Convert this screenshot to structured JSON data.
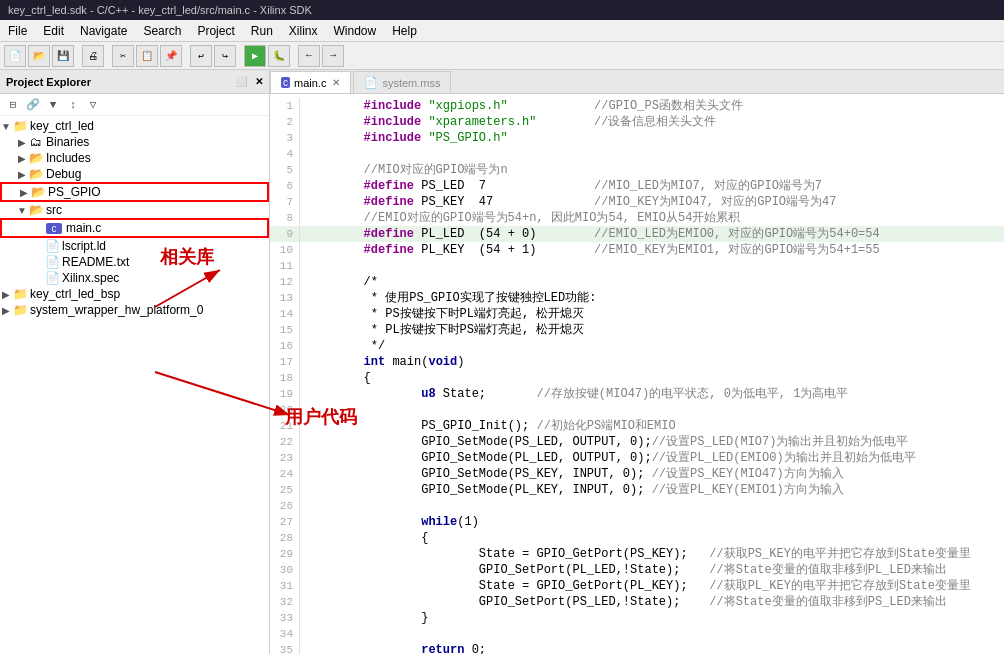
{
  "titlebar": {
    "text": "key_ctrl_led.sdk - C/C++ - key_ctrl_led/src/main.c - Xilinx SDK"
  },
  "menubar": {
    "items": [
      "File",
      "Edit",
      "Navigate",
      "Search",
      "Project",
      "Run",
      "Xilinx",
      "Window",
      "Help"
    ]
  },
  "project_explorer": {
    "title": "Project Explorer",
    "tree": [
      {
        "id": "key_ctrl_led",
        "label": "key_ctrl_led",
        "depth": 0,
        "type": "project",
        "expanded": true
      },
      {
        "id": "binaries",
        "label": "Binaries",
        "depth": 1,
        "type": "folder",
        "expanded": false
      },
      {
        "id": "includes",
        "label": "Includes",
        "depth": 1,
        "type": "folder",
        "expanded": false
      },
      {
        "id": "debug",
        "label": "Debug",
        "depth": 1,
        "type": "folder",
        "expanded": false
      },
      {
        "id": "ps_gpio",
        "label": "PS_GPIO",
        "depth": 1,
        "type": "folder",
        "expanded": false,
        "highlighted": true
      },
      {
        "id": "src",
        "label": "src",
        "depth": 1,
        "type": "folder",
        "expanded": true
      },
      {
        "id": "main_c",
        "label": "main.c",
        "depth": 2,
        "type": "c-file",
        "highlighted": true
      },
      {
        "id": "lscript_ld",
        "label": "lscript.ld",
        "depth": 2,
        "type": "ld-file"
      },
      {
        "id": "readme",
        "label": "README.txt",
        "depth": 2,
        "type": "txt-file"
      },
      {
        "id": "xilinx_spec",
        "label": "Xilinx.spec",
        "depth": 2,
        "type": "spec-file"
      },
      {
        "id": "key_ctrl_led_bsp",
        "label": "key_ctrl_led_bsp",
        "depth": 0,
        "type": "project",
        "expanded": false
      },
      {
        "id": "system_wrapper",
        "label": "system_wrapper_hw_platform_0",
        "depth": 0,
        "type": "project",
        "expanded": false
      }
    ]
  },
  "editor": {
    "tabs": [
      {
        "label": "main.c",
        "active": true,
        "icon": "c-file"
      },
      {
        "label": "system.mss",
        "active": false,
        "icon": "mss-file"
      }
    ],
    "lines": [
      {
        "num": "",
        "content": "\t#include \"xgpiops.h\"\t\t//GPIO_PS函数相关头文件"
      },
      {
        "num": "",
        "content": "\t#include \"xparameters.h\"\t//设备信息相关头文件"
      },
      {
        "num": "",
        "content": "\t#include \"PS_GPIO.h\""
      },
      {
        "num": "",
        "content": ""
      },
      {
        "num": "",
        "content": "\t//MIO对应的GPIO端号为n"
      },
      {
        "num": "",
        "content": "\t#define PS_LED\t7\t\t//MIO_LED为MIO7, 对应的GPIO端号为7"
      },
      {
        "num": "",
        "content": "\t#define PS_KEY\t47\t\t//MIO_KEY为MIO47, 对应的GPIO端号为47"
      },
      {
        "num": "",
        "content": "\t//EMIO对应的GPIO端号为54+n, 因此MIO为54, EMIO从54开始累积"
      },
      {
        "num": "",
        "content": "\t#define PL_LED\t(54 + 0)\t//EMIO_LED为EMIO0, 对应的GPIO端号为54+0=54",
        "highlight": true
      },
      {
        "num": "",
        "content": "\t#define PL_KEY\t(54 + 1)\t//EMIO_KEY为EMIO1, 对应的GPIO端号为54+1=55"
      },
      {
        "num": "",
        "content": ""
      },
      {
        "num": "",
        "content": "\t/*"
      },
      {
        "num": "",
        "content": "\t * 使用PS_GPIO实现了按键独控LED功能:"
      },
      {
        "num": "",
        "content": "\t * PS按键按下时PL端灯亮起, 松开熄灭"
      },
      {
        "num": "",
        "content": "\t * PL按键按下时PS端灯亮起, 松开熄灭"
      },
      {
        "num": "",
        "content": "\t */"
      },
      {
        "num": "",
        "content": "\tint main(void)"
      },
      {
        "num": "",
        "content": "\t{"
      },
      {
        "num": "",
        "content": "\t\tu8 State;\t//存放按键(MIO47)的电平状态, 0为低电平, 1为高电平"
      },
      {
        "num": "",
        "content": ""
      },
      {
        "num": "",
        "content": "\t\tPS_GPIO_Init();\t//初始化PS端MIO和EMIO"
      },
      {
        "num": "",
        "content": "\t\tGPIO_SetMode(PS_LED, OUTPUT, 0);//设置PS_LED(MIO7)为输出并且初始为低电平"
      },
      {
        "num": "",
        "content": "\t\tGPIO_SetMode(PL_LED, OUTPUT, 0);//设置PL_LED(EMIO0)为输出并且初始为低电平"
      },
      {
        "num": "",
        "content": "\t\tGPIO_SetMode(PS_KEY, INPUT, 0); //设置PS_KEY(MIO47)方向为输入"
      },
      {
        "num": "",
        "content": "\t\tGPIO_SetMode(PL_KEY, INPUT, 0); //设置PL_KEY(EMIO1)方向为输入"
      },
      {
        "num": "",
        "content": ""
      },
      {
        "num": "",
        "content": "\t\twhile(1)"
      },
      {
        "num": "",
        "content": "\t\t{"
      },
      {
        "num": "",
        "content": "\t\t\tState = GPIO_GetPort(PS_KEY);\t//获取PS_KEY的电平并把它存放到State变量里"
      },
      {
        "num": "",
        "content": "\t\t\tGPIO_SetPort(PL_LED,!State);\t//将State变量的值取非移到PL_LED来输出"
      },
      {
        "num": "",
        "content": "\t\t\tState = GPIO_GetPort(PL_KEY);\t//获取PL_KEY的电平并把它存放到State变量里"
      },
      {
        "num": "",
        "content": "\t\t\tGPIO_SetPort(PS_LED,!State);\t//将State变量的值取非移到PS_LED来输出"
      },
      {
        "num": "",
        "content": "\t\t}"
      },
      {
        "num": "",
        "content": ""
      },
      {
        "num": "",
        "content": "\t\treturn 0;"
      },
      {
        "num": "",
        "content": "\t}"
      }
    ]
  },
  "annotations": {
    "arrow1_text": "相关库",
    "arrow2_text": "用户代码"
  }
}
